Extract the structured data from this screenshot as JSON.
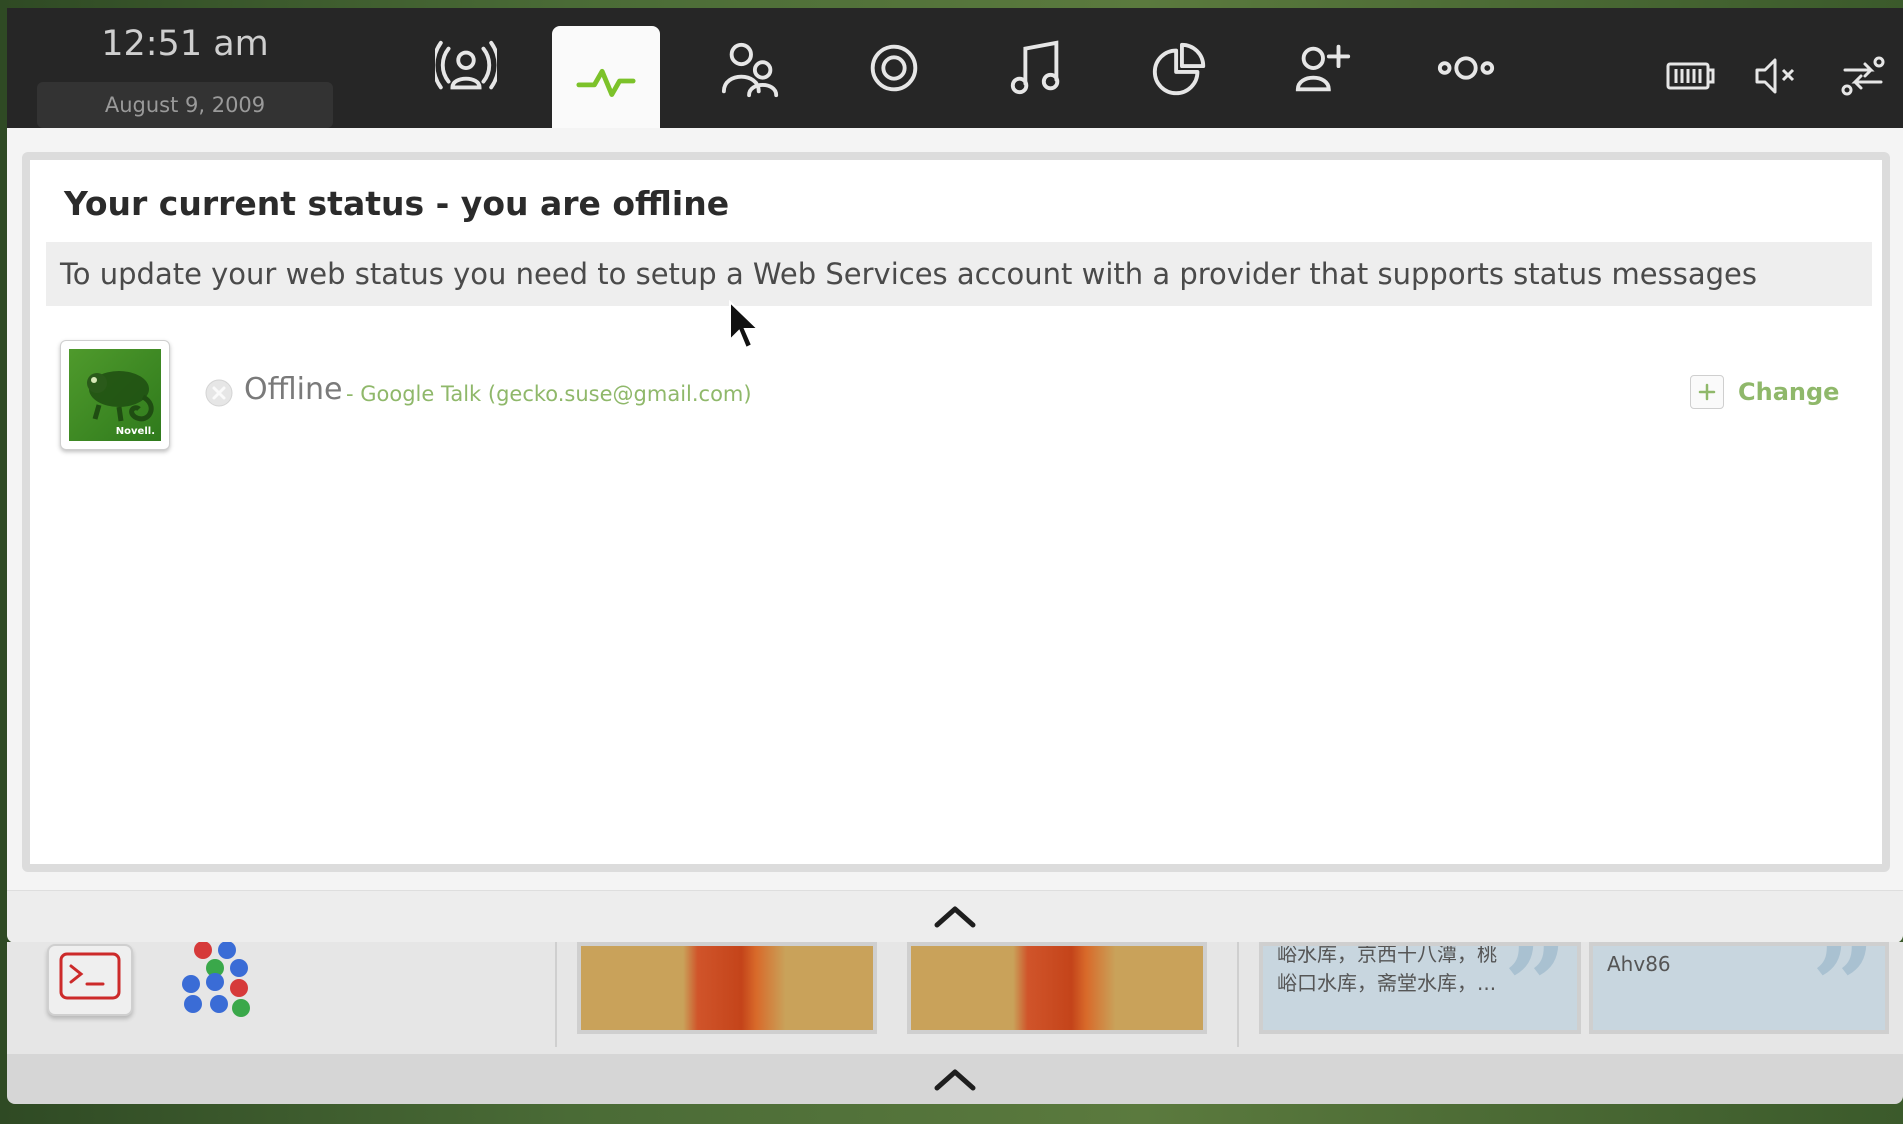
{
  "topbar": {
    "time": "12:51 am",
    "date": "August  9, 2009",
    "tabs": [
      {
        "icon": "broadcast-person-icon"
      },
      {
        "icon": "activity-pulse-icon",
        "active": true
      },
      {
        "icon": "people-icon"
      },
      {
        "icon": "target-icon"
      },
      {
        "icon": "music-note-icon"
      },
      {
        "icon": "pie-chart-icon"
      },
      {
        "icon": "add-person-icon"
      },
      {
        "icon": "more-dots-icon"
      }
    ],
    "system": [
      "battery-icon",
      "volume-muted-icon",
      "network-icon"
    ],
    "accent": "#7cc22a"
  },
  "status": {
    "title": "Your current status - you are offline",
    "message": "To update your web status you need to setup a Web Services account with a provider that supports status messages",
    "state": "Offline",
    "account": "- Google Talk (gecko.suse@gmail.com)",
    "change_label": "Change",
    "avatar_caption": "Novell."
  },
  "strip": {
    "note1": "峪口水库，斋堂水库，...",
    "note1_top": "峪水库，京西十八潭，桃",
    "note2": "Ahv86",
    "quote_glyph": "”"
  }
}
